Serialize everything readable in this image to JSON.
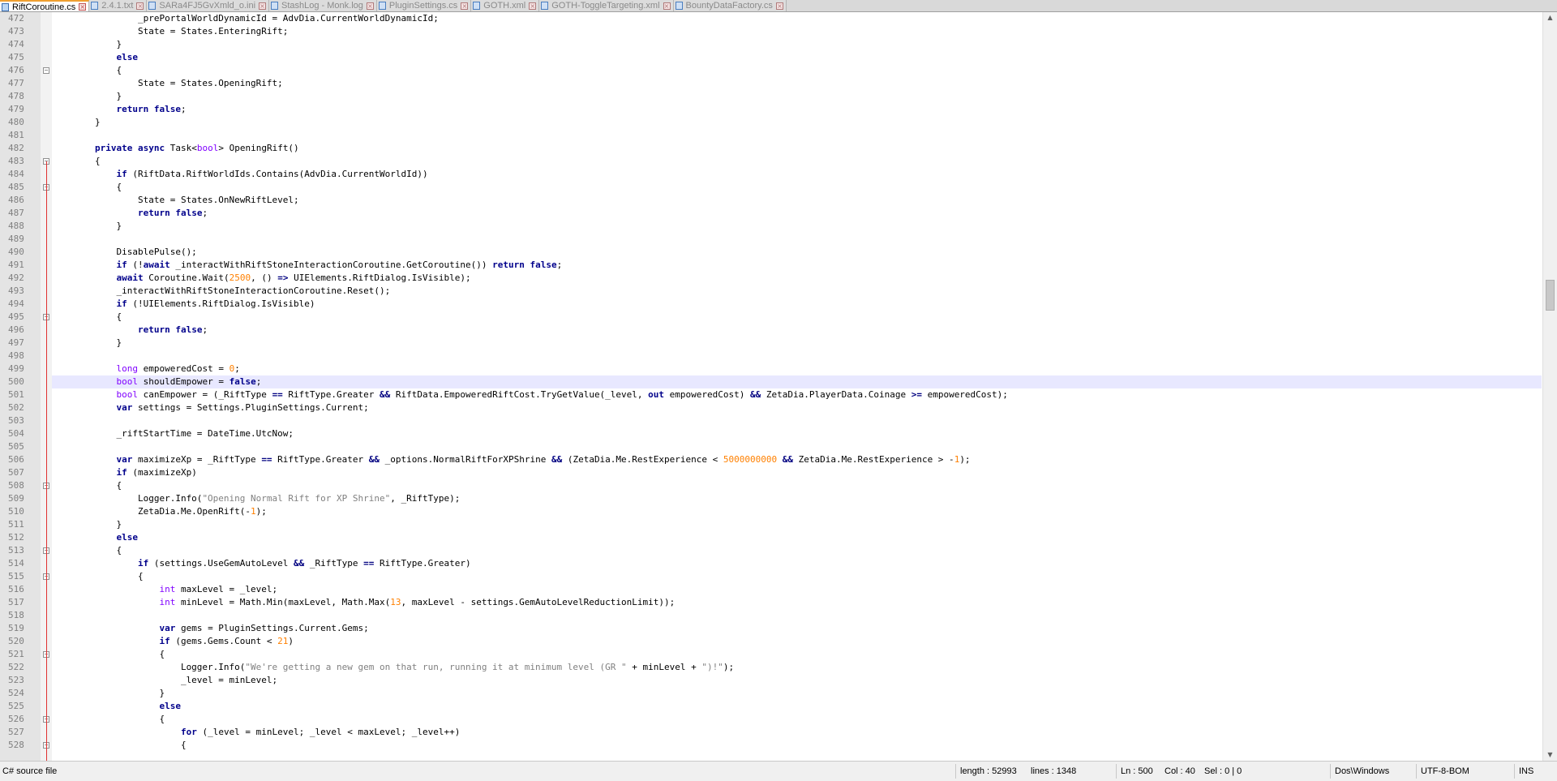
{
  "tabs": [
    {
      "label": "RiftCoroutine.cs",
      "active": true
    },
    {
      "label": "2.4.1.txt",
      "active": false
    },
    {
      "label": "SARa4FJ5GvXmld_o.ini",
      "active": false
    },
    {
      "label": "StashLog - Monk.log",
      "active": false
    },
    {
      "label": "PluginSettings.cs",
      "active": false
    },
    {
      "label": "GOTH.xml",
      "active": false
    },
    {
      "label": "GOTH-ToggleTargeting.xml",
      "active": false
    },
    {
      "label": "BountyDataFactory.cs",
      "active": false
    }
  ],
  "editor": {
    "current_line": "500",
    "line_numbers": [
      "472",
      "473",
      "474",
      "475",
      "476",
      "477",
      "478",
      "479",
      "480",
      "481",
      "482",
      "483",
      "484",
      "485",
      "486",
      "487",
      "488",
      "489",
      "490",
      "491",
      "492",
      "493",
      "494",
      "495",
      "496",
      "497",
      "498",
      "499",
      "500",
      "501",
      "502",
      "503",
      "504",
      "505",
      "506",
      "507",
      "508",
      "509",
      "510",
      "511",
      "512",
      "513",
      "514",
      "515",
      "516",
      "517",
      "518",
      "519",
      "520",
      "521",
      "522",
      "523",
      "524",
      "525",
      "526",
      "527",
      "528"
    ],
    "lines": [
      "                _prePortalWorldDynamicId = AdvDia.CurrentWorldDynamicId;",
      "                State = States.EnteringRift;",
      "            }",
      "            else",
      "            {",
      "                State = States.OpeningRift;",
      "            }",
      "            return false;",
      "        }",
      "",
      "        private async Task<bool> OpeningRift()",
      "        {",
      "            if (RiftData.RiftWorldIds.Contains(AdvDia.CurrentWorldId))",
      "            {",
      "                State = States.OnNewRiftLevel;",
      "                return false;",
      "            }",
      "",
      "            DisablePulse();",
      "            if (!await _interactWithRiftStoneInteractionCoroutine.GetCoroutine()) return false;",
      "            await Coroutine.Wait(2500, () => UIElements.RiftDialog.IsVisible);",
      "            _interactWithRiftStoneInteractionCoroutine.Reset();",
      "            if (!UIElements.RiftDialog.IsVisible)",
      "            {",
      "                return false;",
      "            }",
      "",
      "            long empoweredCost = 0;",
      "            bool shouldEmpower = false;",
      "            bool canEmpower = (_RiftType == RiftType.Greater && RiftData.EmpoweredRiftCost.TryGetValue(_level, out empoweredCost) && ZetaDia.PlayerData.Coinage >= empoweredCost);",
      "            var settings = Settings.PluginSettings.Current;",
      "",
      "            _riftStartTime = DateTime.UtcNow;",
      "",
      "            var maximizeXp = _RiftType == RiftType.Greater && _options.NormalRiftForXPShrine && (ZetaDia.Me.RestExperience < 5000000000 && ZetaDia.Me.RestExperience > -1);",
      "            if (maximizeXp)",
      "            {",
      "                Logger.Info(\"Opening Normal Rift for XP Shrine\", _RiftType);",
      "                ZetaDia.Me.OpenRift(-1);",
      "            }",
      "            else",
      "            {",
      "                if (settings.UseGemAutoLevel && _RiftType == RiftType.Greater)",
      "                {",
      "                    int maxLevel = _level;",
      "                    int minLevel = Math.Min(maxLevel, Math.Max(13, maxLevel - settings.GemAutoLevelReductionLimit));",
      "",
      "                    var gems = PluginSettings.Current.Gems;",
      "                    if (gems.Gems.Count < 21)",
      "                    {",
      "                        Logger.Info(\"We're getting a new gem on that run, running it at minimum level (GR \" + minLevel + \")!\");",
      "                        _level = minLevel;",
      "                    }",
      "                    else",
      "                    {",
      "                        for (_level = minLevel; _level < maxLevel; _level++)",
      "                        {"
    ]
  },
  "statusbar": {
    "file_type": "C# source file",
    "length": "length : 52993",
    "lines": "lines : 1348",
    "ln": "Ln : 500",
    "col": "Col : 40",
    "sel": "Sel : 0 | 0",
    "eol": "Dos\\Windows",
    "encoding": "UTF-8-BOM",
    "mode": "INS"
  },
  "colors": {
    "keyword": "#00008b",
    "type": "#8000ff",
    "number": "#ff8000",
    "string": "#808080",
    "current_line_bg": "#e8e8ff",
    "fold_line": "#e03030",
    "active_tab_accent": "#f0a030"
  },
  "icons": {
    "tab_file": "file-icon",
    "tab_close": "close-icon",
    "fold_open": "fold-minus-icon",
    "scroll_up": "arrow-up-icon",
    "scroll_down": "arrow-down-icon"
  }
}
